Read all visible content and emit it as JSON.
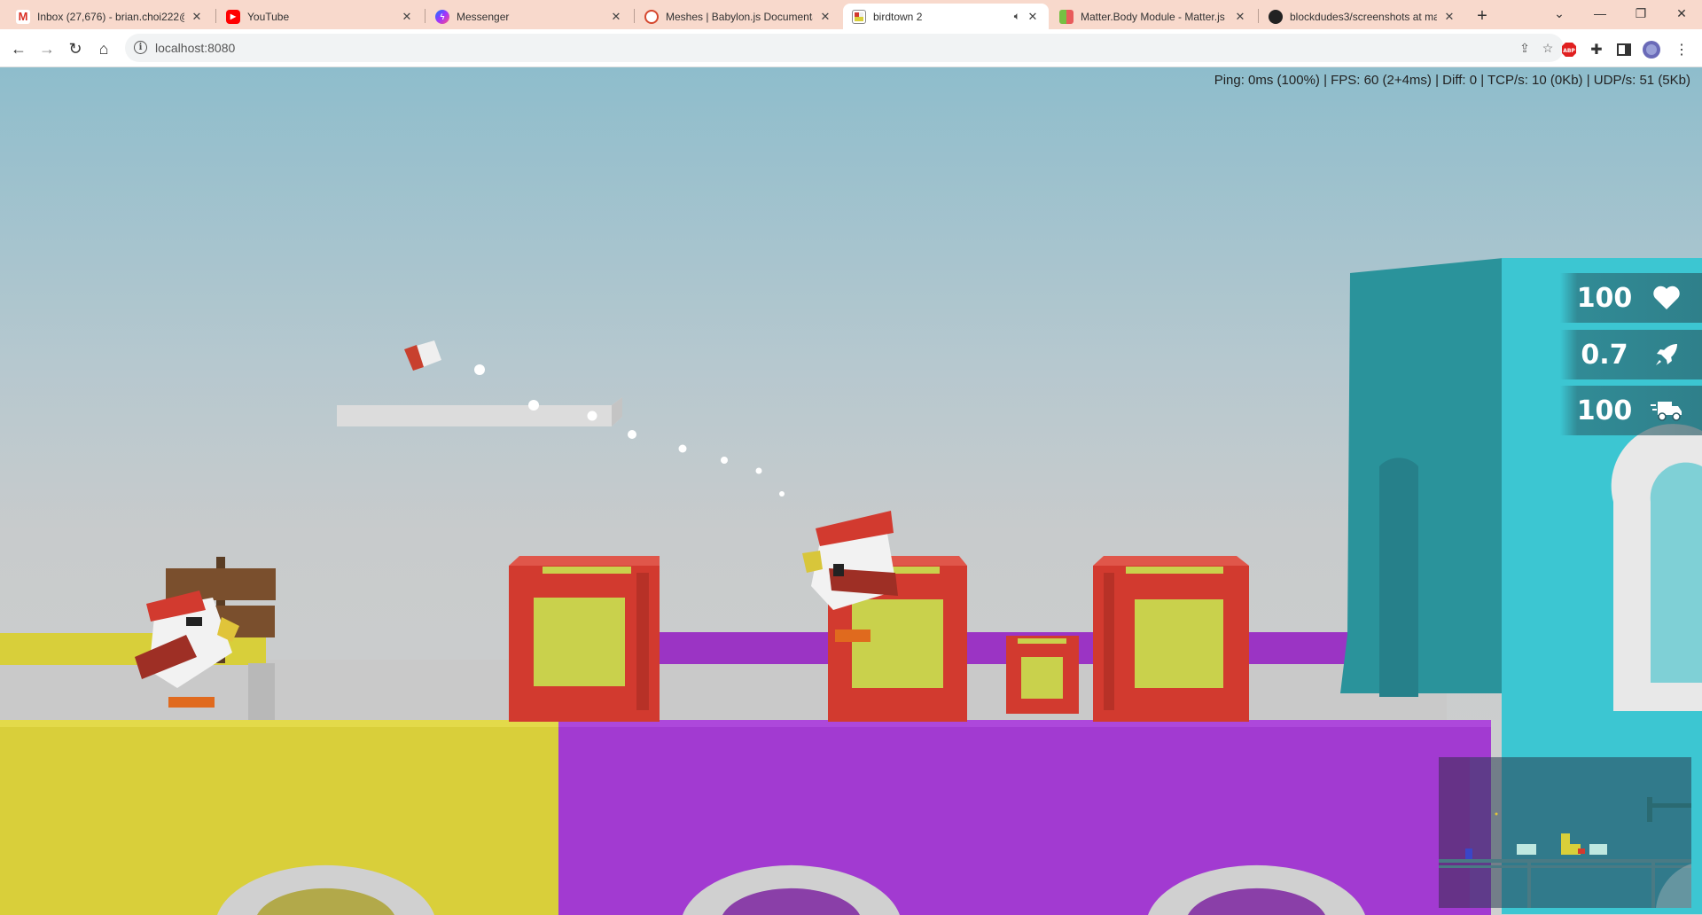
{
  "browser": {
    "tabs": [
      {
        "title": "Inbox (27,676) - brian.choi222@",
        "icon": "gmail-icon",
        "active": false
      },
      {
        "title": "YouTube",
        "icon": "youtube-icon",
        "active": false
      },
      {
        "title": "Messenger",
        "icon": "messenger-icon",
        "active": false
      },
      {
        "title": "Meshes | Babylon.js Documenta",
        "icon": "babylonjs-icon",
        "active": false
      },
      {
        "title": "birdtown 2",
        "icon": "birdtown-icon",
        "active": true,
        "audio": true
      },
      {
        "title": "Matter.Body Module - Matter.js",
        "icon": "matterjs-icon",
        "active": false
      },
      {
        "title": "blockdudes3/screenshots at ma",
        "icon": "github-icon",
        "active": false
      }
    ],
    "url": "localhost:8080"
  },
  "game": {
    "stats_text": "Ping: 0ms (100%) | FPS: 60 (2+4ms) | Diff: 0 | TCP/s: 10 (0Kb) | UDP/s: 51 (5Kb)",
    "hud": {
      "health": "100",
      "health_icon": "heart-icon",
      "rocket": "0.7",
      "rocket_icon": "rocket-icon",
      "ammo": "100",
      "ammo_icon": "truck-fast-icon"
    },
    "colors": {
      "crate_red": "#d23a2f",
      "crate_yellow": "#c9d14c",
      "purple": "#a23ad1",
      "yellow": "#d9cf3a",
      "teal": "#2a9aa2",
      "cyan": "#3cc6d2"
    }
  }
}
